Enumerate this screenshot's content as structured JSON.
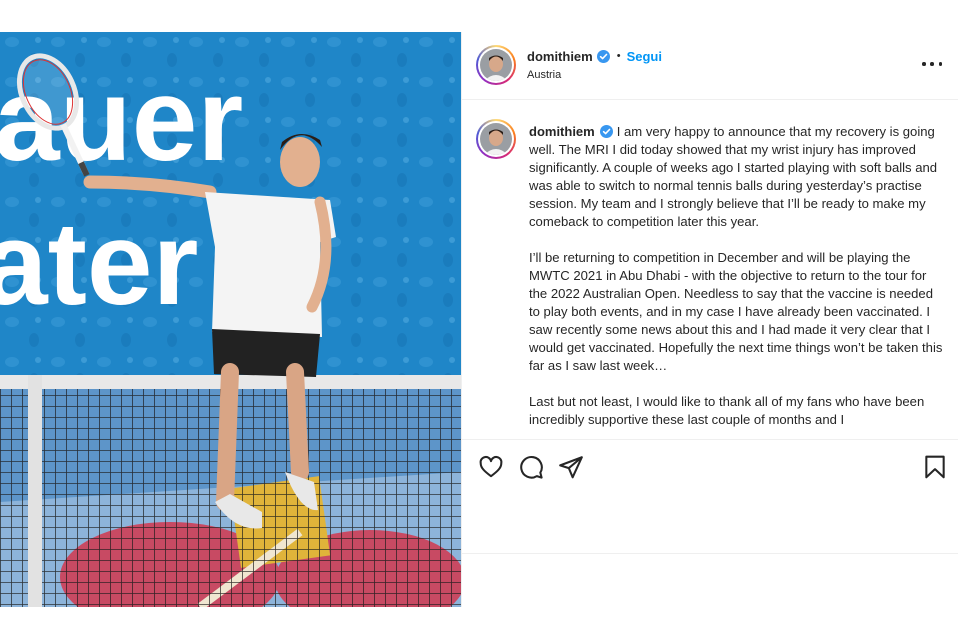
{
  "post": {
    "username": "domithiem",
    "follow_label": "Segui",
    "dot": "•",
    "location": "Austria",
    "caption": {
      "username": "domithiem",
      "paragraph1": "I am very happy to announce that my recovery is going well. The MRI I did today showed that my wrist injury has improved significantly. A couple of weeks ago I started playing with soft balls and was able to switch to normal tennis balls during yesterday’s practise session. My team and I strongly believe that I’ll be ready to make my comeback to competition later this year.",
      "paragraph2": "I’ll be returning to competition in December and will be playing the MWTC 2021 in Abu Dhabi - with the objective to return to the tour for the 2022 Australian Open. Needless to say that the vaccine is needed to play both events, and in my case I have already been vaccinated. I saw recently some news about this and I had made it very clear that I would get vaccinated. Hopefully the next time things won’t be taken this far as I saw last week…",
      "paragraph3": "Last but not least, I would like to thank all of my fans who have been incredibly supportive these last couple of months and I"
    },
    "photo_banner_text": [
      "auer",
      "ater"
    ],
    "icons": [
      "verified-badge-icon",
      "more-options-icon",
      "heart-icon",
      "comment-icon",
      "share-icon",
      "bookmark-icon"
    ],
    "colors": {
      "accent": "#0095f6",
      "banner": "#1f86c8",
      "text": "#262626"
    }
  }
}
